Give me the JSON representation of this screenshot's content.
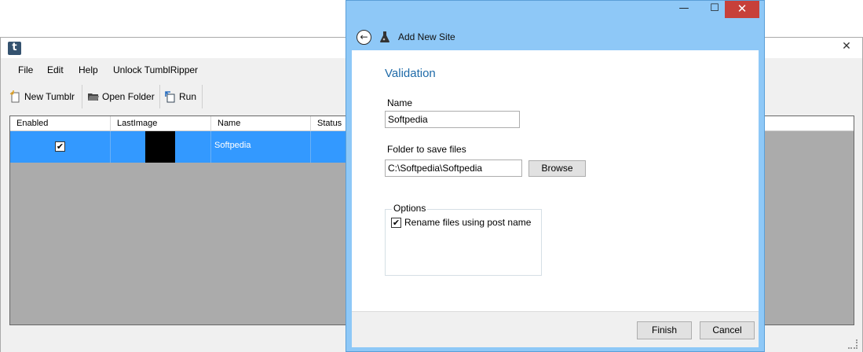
{
  "main": {
    "app_icon_letter": "t",
    "close_glyph": "✕",
    "menu": [
      "File",
      "Edit",
      "Help",
      "Unlock TumblRipper"
    ],
    "toolbar": {
      "new_tumblr": "New Tumblr",
      "open_folder": "Open Folder",
      "run": "Run"
    },
    "grid": {
      "columns": [
        "Enabled",
        "LastImage",
        "Name",
        "Status"
      ],
      "rows": [
        {
          "enabled": "✔",
          "name": "Softpedia"
        }
      ]
    }
  },
  "dialog": {
    "title": "Add New Site",
    "minimize_glyph": "—",
    "maximize_glyph": "☐",
    "close_glyph": "✕",
    "back_glyph": "←",
    "heading": "Validation",
    "name_label": "Name",
    "name_value": "Softpedia",
    "folder_label": "Folder to save files",
    "folder_value": "C:\\Softpedia\\Softpedia",
    "browse_label": "Browse",
    "options_label": "Options",
    "rename_label": "Rename files using post name",
    "rename_checked": "✔",
    "finish_label": "Finish",
    "cancel_label": "Cancel"
  },
  "colors": {
    "selection": "#3399ff",
    "dialog_frame": "#8ec8f7",
    "heading": "#1e6aa8",
    "close_red": "#c7403a"
  }
}
